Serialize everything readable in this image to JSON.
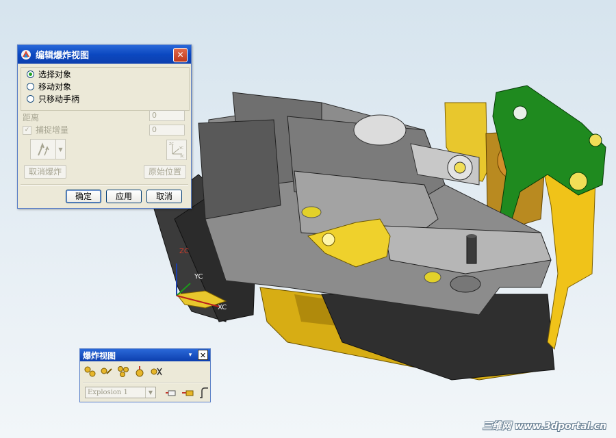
{
  "dialog": {
    "title": "编辑爆炸视图",
    "close": "✕",
    "options": [
      "选择对象",
      "移动对象",
      "只移动手柄"
    ],
    "selected_option": "选择对象",
    "distance_label": "距离",
    "distance_value": "0",
    "snap_label": "捕捉增量",
    "snap_value": "0",
    "cancel_explode_label": "取消爆炸",
    "original_position_label": "原始位置",
    "ok_label": "确定",
    "apply_label": "应用",
    "cancel_label": "取消"
  },
  "toolbar": {
    "title": "爆炸视图",
    "dropdown": "▾",
    "close": "✕",
    "explosion_select": "Explosion 1"
  },
  "axes": {
    "zc": "ZC",
    "yc": "YC",
    "xc": "XC"
  },
  "watermark": "三维网 www.3dportal.cn"
}
